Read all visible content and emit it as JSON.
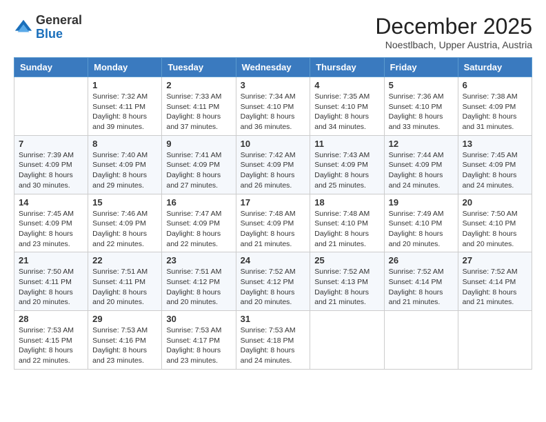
{
  "logo": {
    "general": "General",
    "blue": "Blue"
  },
  "header": {
    "month_year": "December 2025",
    "location": "Noestlbach, Upper Austria, Austria"
  },
  "days_of_week": [
    "Sunday",
    "Monday",
    "Tuesday",
    "Wednesday",
    "Thursday",
    "Friday",
    "Saturday"
  ],
  "weeks": [
    [
      {
        "day": "",
        "content": ""
      },
      {
        "day": "1",
        "content": "Sunrise: 7:32 AM\nSunset: 4:11 PM\nDaylight: 8 hours\nand 39 minutes."
      },
      {
        "day": "2",
        "content": "Sunrise: 7:33 AM\nSunset: 4:11 PM\nDaylight: 8 hours\nand 37 minutes."
      },
      {
        "day": "3",
        "content": "Sunrise: 7:34 AM\nSunset: 4:10 PM\nDaylight: 8 hours\nand 36 minutes."
      },
      {
        "day": "4",
        "content": "Sunrise: 7:35 AM\nSunset: 4:10 PM\nDaylight: 8 hours\nand 34 minutes."
      },
      {
        "day": "5",
        "content": "Sunrise: 7:36 AM\nSunset: 4:10 PM\nDaylight: 8 hours\nand 33 minutes."
      },
      {
        "day": "6",
        "content": "Sunrise: 7:38 AM\nSunset: 4:09 PM\nDaylight: 8 hours\nand 31 minutes."
      }
    ],
    [
      {
        "day": "7",
        "content": "Sunrise: 7:39 AM\nSunset: 4:09 PM\nDaylight: 8 hours\nand 30 minutes."
      },
      {
        "day": "8",
        "content": "Sunrise: 7:40 AM\nSunset: 4:09 PM\nDaylight: 8 hours\nand 29 minutes."
      },
      {
        "day": "9",
        "content": "Sunrise: 7:41 AM\nSunset: 4:09 PM\nDaylight: 8 hours\nand 27 minutes."
      },
      {
        "day": "10",
        "content": "Sunrise: 7:42 AM\nSunset: 4:09 PM\nDaylight: 8 hours\nand 26 minutes."
      },
      {
        "day": "11",
        "content": "Sunrise: 7:43 AM\nSunset: 4:09 PM\nDaylight: 8 hours\nand 25 minutes."
      },
      {
        "day": "12",
        "content": "Sunrise: 7:44 AM\nSunset: 4:09 PM\nDaylight: 8 hours\nand 24 minutes."
      },
      {
        "day": "13",
        "content": "Sunrise: 7:45 AM\nSunset: 4:09 PM\nDaylight: 8 hours\nand 24 minutes."
      }
    ],
    [
      {
        "day": "14",
        "content": "Sunrise: 7:45 AM\nSunset: 4:09 PM\nDaylight: 8 hours\nand 23 minutes."
      },
      {
        "day": "15",
        "content": "Sunrise: 7:46 AM\nSunset: 4:09 PM\nDaylight: 8 hours\nand 22 minutes."
      },
      {
        "day": "16",
        "content": "Sunrise: 7:47 AM\nSunset: 4:09 PM\nDaylight: 8 hours\nand 22 minutes."
      },
      {
        "day": "17",
        "content": "Sunrise: 7:48 AM\nSunset: 4:09 PM\nDaylight: 8 hours\nand 21 minutes."
      },
      {
        "day": "18",
        "content": "Sunrise: 7:48 AM\nSunset: 4:10 PM\nDaylight: 8 hours\nand 21 minutes."
      },
      {
        "day": "19",
        "content": "Sunrise: 7:49 AM\nSunset: 4:10 PM\nDaylight: 8 hours\nand 20 minutes."
      },
      {
        "day": "20",
        "content": "Sunrise: 7:50 AM\nSunset: 4:10 PM\nDaylight: 8 hours\nand 20 minutes."
      }
    ],
    [
      {
        "day": "21",
        "content": "Sunrise: 7:50 AM\nSunset: 4:11 PM\nDaylight: 8 hours\nand 20 minutes."
      },
      {
        "day": "22",
        "content": "Sunrise: 7:51 AM\nSunset: 4:11 PM\nDaylight: 8 hours\nand 20 minutes."
      },
      {
        "day": "23",
        "content": "Sunrise: 7:51 AM\nSunset: 4:12 PM\nDaylight: 8 hours\nand 20 minutes."
      },
      {
        "day": "24",
        "content": "Sunrise: 7:52 AM\nSunset: 4:12 PM\nDaylight: 8 hours\nand 20 minutes."
      },
      {
        "day": "25",
        "content": "Sunrise: 7:52 AM\nSunset: 4:13 PM\nDaylight: 8 hours\nand 21 minutes."
      },
      {
        "day": "26",
        "content": "Sunrise: 7:52 AM\nSunset: 4:14 PM\nDaylight: 8 hours\nand 21 minutes."
      },
      {
        "day": "27",
        "content": "Sunrise: 7:52 AM\nSunset: 4:14 PM\nDaylight: 8 hours\nand 21 minutes."
      }
    ],
    [
      {
        "day": "28",
        "content": "Sunrise: 7:53 AM\nSunset: 4:15 PM\nDaylight: 8 hours\nand 22 minutes."
      },
      {
        "day": "29",
        "content": "Sunrise: 7:53 AM\nSunset: 4:16 PM\nDaylight: 8 hours\nand 23 minutes."
      },
      {
        "day": "30",
        "content": "Sunrise: 7:53 AM\nSunset: 4:17 PM\nDaylight: 8 hours\nand 23 minutes."
      },
      {
        "day": "31",
        "content": "Sunrise: 7:53 AM\nSunset: 4:18 PM\nDaylight: 8 hours\nand 24 minutes."
      },
      {
        "day": "",
        "content": ""
      },
      {
        "day": "",
        "content": ""
      },
      {
        "day": "",
        "content": ""
      }
    ]
  ]
}
